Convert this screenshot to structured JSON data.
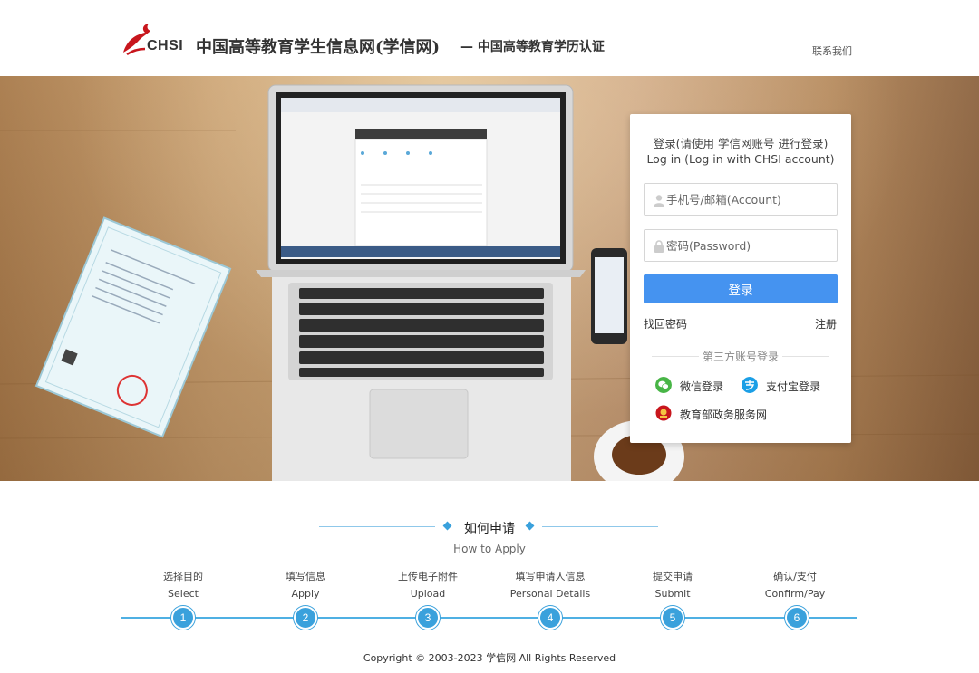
{
  "header": {
    "logo_text": "CHSI",
    "title": "中国高等教育学生信息网(学信网)",
    "subtitle": "— 中国高等教育学历认证",
    "contact": "联系我们"
  },
  "login": {
    "title_cn": "登录(请使用 学信网账号 进行登录)",
    "title_en": "Log in (Log in with CHSI account)",
    "account_placeholder": "手机号/邮箱(Account)",
    "password_placeholder": "密码(Password)",
    "login_button": "登录",
    "forgot_password": "找回密码",
    "register": "注册",
    "third_party_label": "第三方账号登录",
    "wechat": "微信登录",
    "alipay": "支付宝登录",
    "moe": "教育部政务服务网"
  },
  "howto": {
    "title": "如何申请",
    "title_en": "How to Apply",
    "steps": [
      {
        "cn": "选择目的",
        "en": "Select",
        "num": "1"
      },
      {
        "cn": "填写信息",
        "en": "Apply",
        "num": "2"
      },
      {
        "cn": "上传电子附件",
        "en": "Upload",
        "num": "3"
      },
      {
        "cn": "填写申请人信息",
        "en": "Personal Details",
        "num": "4"
      },
      {
        "cn": "提交申请",
        "en": "Submit",
        "num": "5"
      },
      {
        "cn": "确认/支付",
        "en": "Confirm/Pay",
        "num": "6"
      }
    ]
  },
  "footer": {
    "copyright": "Copyright © 2003-2023 学信网 All Rights Reserved"
  },
  "colors": {
    "primary_button": "#4593f0",
    "step_accent": "#3aa1dc",
    "logo_red": "#c8161d"
  }
}
